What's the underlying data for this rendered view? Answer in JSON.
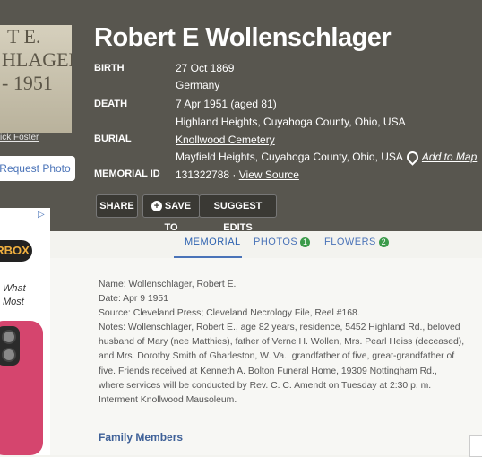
{
  "memorial": {
    "name": "Robert E Wollenschlager",
    "grave_lines": [
      "T E.",
      "HLAGER",
      "- 1951"
    ],
    "photo_credit": "ick Foster",
    "request_photo": "Request Photo",
    "birth_label": "BIRTH",
    "birth_date": "27 Oct 1869",
    "birth_place": "Germany",
    "death_label": "DEATH",
    "death_date": "7 Apr 1951 (aged 81)",
    "death_place": "Highland Heights, Cuyahoga County, Ohio, USA",
    "burial_label": "BURIAL",
    "burial_cemetery": "Knollwood Cemetery",
    "burial_place": "Mayfield Heights, Cuyahoga County, Ohio, USA",
    "add_to_map": "Add to Map",
    "memorial_id_label": "MEMORIAL ID",
    "memorial_id": "131322788 ·",
    "view_source": "View Source"
  },
  "actions": {
    "share": "SHARE",
    "save_to": "SAVE TO",
    "suggest_edits": "SUGGEST EDITS"
  },
  "ad": {
    "box": "RBOX",
    "line1": "What",
    "line2": "Most"
  },
  "tabs": {
    "memorial": "MEMORIAL",
    "photos": "PHOTOS",
    "photos_count": "1",
    "flowers": "FLOWERS",
    "flowers_count": "2"
  },
  "notes": [
    "Name: Wollenschlager, Robert E.",
    "Date: Apr 9 1951",
    "Source: Cleveland Press; Cleveland Necrology File, Reel #168.",
    "Notes: Wollenschlager, Robert E., age 82 years, residence, 5452 Highland Rd., beloved",
    "husband of Mary (nee Matthies), father of Verne H. Wollen, Mrs. Pearl Heiss (deceased),",
    "and Mrs. Dorothy Smith of Gharleston, W. Va., grandfather of five, great-grandfather of",
    "five. Friends received at Kenneth A. Bolton Funeral Home, 19309 Nottingham Rd.,",
    "where services will be conducted by Rev. C. C. Amendt on Tuesday at 2:30 p. m.",
    "Interment Knollwood Mausoleum."
  ],
  "family_members": "Family Members"
}
